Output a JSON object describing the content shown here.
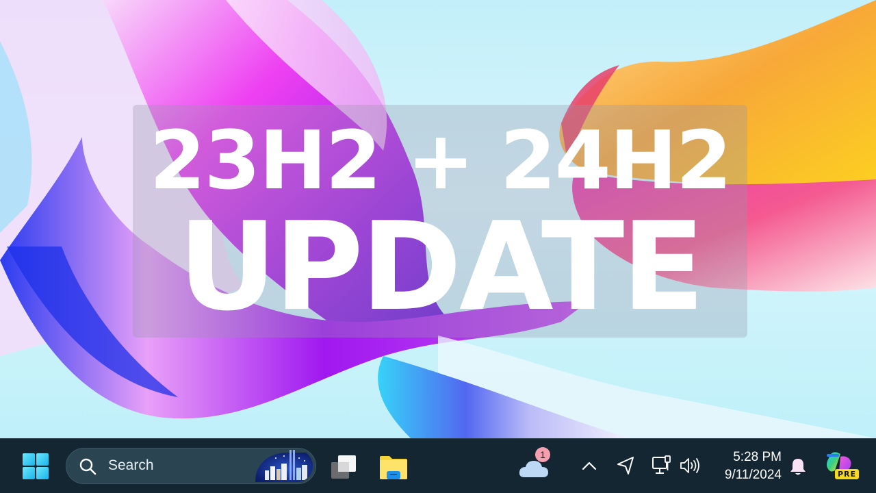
{
  "wallpaper": {
    "colors": {
      "sky": "#c2effa",
      "magenta": "#e832f0",
      "violet": "#7a18e0",
      "blue": "#2a3cf0",
      "pink": "#f04a9a",
      "orange": "#f5a030",
      "yellow": "#fcd830",
      "cyan": "#30c8f0"
    }
  },
  "overlay": {
    "line1": "23H2 + 24H2",
    "line2": "UPDATE"
  },
  "taskbar": {
    "start": {
      "icon": "windows-logo-icon",
      "accent": "#38d0f8"
    },
    "search": {
      "placeholder": "Search",
      "icon": "search-icon",
      "art": "city-skyline-highlight"
    },
    "task_view": {
      "icon": "task-view-icon"
    },
    "file_explorer": {
      "icon": "folder-icon"
    },
    "weather": {
      "icon": "cloud-icon",
      "badge": "1"
    },
    "tray": {
      "chevron": "chevron-up-icon",
      "location": "location-arrow-icon",
      "network": "ethernet-monitor-icon",
      "volume": "speaker-icon"
    },
    "clock": {
      "time": "5:28 PM",
      "date": "9/11/2024"
    },
    "notifications": {
      "icon": "bell-icon"
    },
    "copilot": {
      "icon": "copilot-icon",
      "badge": "PRE"
    }
  }
}
